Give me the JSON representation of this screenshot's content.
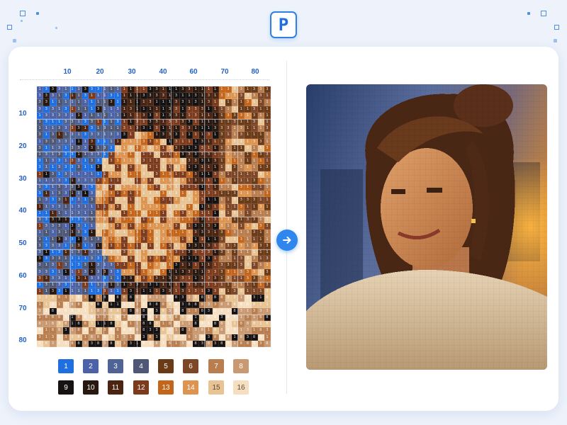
{
  "app": {
    "logo_letter": "P",
    "accent": "#2f86ec"
  },
  "grid": {
    "column_labels": [
      "10",
      "20",
      "30",
      "40",
      "60",
      "70",
      "80"
    ],
    "row_labels": [
      "10",
      "20",
      "30",
      "40",
      "50",
      "60",
      "70",
      "80"
    ]
  },
  "palette": [
    {
      "label": "1",
      "color": "#1f6fe0"
    },
    {
      "label": "2",
      "color": "#4b62a8"
    },
    {
      "label": "3",
      "color": "#4f6397"
    },
    {
      "label": "4",
      "color": "#4e5876"
    },
    {
      "label": "5",
      "color": "#6b3a17"
    },
    {
      "label": "6",
      "color": "#7d4727"
    },
    {
      "label": "7",
      "color": "#b97e4f"
    },
    {
      "label": "8",
      "color": "#c99a72"
    },
    {
      "label": "9",
      "color": "#161212"
    },
    {
      "label": "10",
      "color": "#281810"
    },
    {
      "label": "11",
      "color": "#4b2412"
    },
    {
      "label": "12",
      "color": "#7b3b1c"
    },
    {
      "label": "13",
      "color": "#c3661c"
    },
    {
      "label": "14",
      "color": "#dc9450"
    },
    {
      "label": "15",
      "color": "#e8c394"
    },
    {
      "label": "16",
      "color": "#f6dfc1"
    }
  ],
  "icons": {
    "convert_button": "arrow-right-icon"
  }
}
